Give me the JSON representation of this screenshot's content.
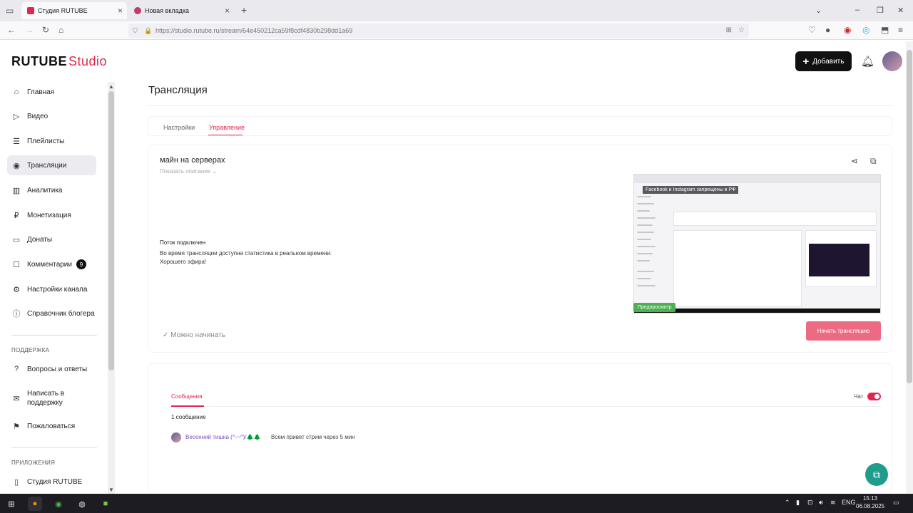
{
  "browser": {
    "tabs": [
      {
        "title": "Студия RUTUBE",
        "active": true
      },
      {
        "title": "Новая вкладка",
        "active": false
      }
    ],
    "url": "https://studio.rutube.ru/stream/64e450212ca59f8cdf4830b298dd1a69"
  },
  "header": {
    "logo_main": "RUTUBE",
    "logo_studio": "Studio",
    "add_label": "Добавить"
  },
  "sidebar": {
    "items": [
      {
        "label": "Главная",
        "icon": "home-icon"
      },
      {
        "label": "Видео",
        "icon": "video-icon"
      },
      {
        "label": "Плейлисты",
        "icon": "playlist-icon"
      },
      {
        "label": "Трансляции",
        "icon": "broadcast-icon"
      },
      {
        "label": "Аналитика",
        "icon": "analytics-icon"
      },
      {
        "label": "Монетизация",
        "icon": "monetization-icon"
      },
      {
        "label": "Донаты",
        "icon": "donate-icon"
      },
      {
        "label": "Комментарии",
        "icon": "comments-icon",
        "badge": "9"
      },
      {
        "label": "Настройки канала",
        "icon": "gear-icon"
      },
      {
        "label": "Справочник блогера",
        "icon": "info-icon"
      }
    ],
    "support_title": "ПОДДЕРЖКА",
    "support_items": [
      {
        "label": "Вопросы и ответы",
        "icon": "question-icon"
      },
      {
        "label": "Написать в поддержку",
        "icon": "mail-icon"
      },
      {
        "label": "Пожаловаться",
        "icon": "flag-icon"
      }
    ],
    "apps_title": "ПРИЛОЖЕНИЯ",
    "apps_items": [
      {
        "label": "Студия RUTUBE",
        "icon": "phone-icon"
      }
    ]
  },
  "main": {
    "page_title": "Трансляция",
    "tabs": [
      {
        "label": "Настройки"
      },
      {
        "label": "Управление"
      }
    ],
    "stream": {
      "name": "майн на серверах",
      "show_description": "Показать описание",
      "status_title": "Поток подключен",
      "status_line1": "Во время трансляции доступна статистика в реальном времени.",
      "status_line2": "Хорошего эфира!",
      "preview_banner": "Facebook и Instagram запрещены в РФ",
      "preview_label": "Предпросмотр",
      "ready_text": "Можно начинать",
      "start_label": "Начать трансляцию"
    },
    "chat": {
      "messages_tab": "Сообщения",
      "chat_label": "Чат",
      "chat_enabled": true,
      "count": "1 сообщение",
      "messages": [
        {
          "author": "Весенний тишка (^-~^)/🌲🌲",
          "text": "Всем привет стрим через 5 мин"
        }
      ]
    }
  },
  "taskbar": {
    "lang": "ENG",
    "time": "15:13",
    "date": "06.08.2025"
  },
  "colors": {
    "accent": "#e3264f",
    "start_button": "#ec6a82",
    "preview_label": "#4caf50",
    "help_button": "#1f9c8c"
  }
}
